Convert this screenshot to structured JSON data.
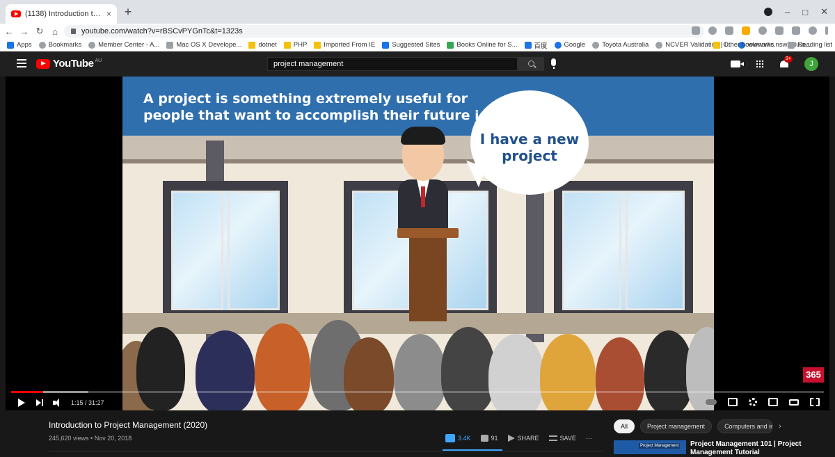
{
  "browser": {
    "tab_title": "(1138) Introduction to Project M",
    "tab_close": "×",
    "new_tab": "+",
    "url": "youtube.com/watch?v=rBSCvPYGnTc&t=1323s",
    "bookmarks": [
      "Apps",
      "Bookmarks",
      "Member Center - A...",
      "Mac OS X Develope...",
      "dotnet",
      "PHP",
      "Imported From IE",
      "Suggested Sites",
      "Books Online for S...",
      "百度",
      "Google",
      "Toyota Australia",
      "NCVER Validation | I...",
      "www.wic.nsw.edu.a..."
    ],
    "other_bookmarks": "Other bookmarks",
    "reading_list": "Reading list"
  },
  "youtube": {
    "logo_text": "YouTube",
    "region": "AU",
    "search_value": "project management",
    "notification_badge": "9+",
    "avatar_letter": "J"
  },
  "video": {
    "banner_line1": "A project is something extremely useful for",
    "banner_line2": "people that want to accomplish their future ideas",
    "bubble_line1": "I have a new",
    "bubble_line2": "project",
    "watermark": "365",
    "time": "1:15 / 31:27",
    "progress_fraction": 0.0397,
    "buffered_fraction": 0.095
  },
  "details": {
    "title": "Introduction to Project Management (2020)",
    "meta": "245,620 views • Nov 20, 2018",
    "likes": "3.4K",
    "dislikes": "91",
    "share": "SHARE",
    "save": "SAVE",
    "more": "···"
  },
  "sidebar": {
    "chips": [
      "All",
      "Project management",
      "Computers and in"
    ],
    "next": "›",
    "rec_thumb_label": "Project Management",
    "rec_title": "Project Management 101 | Project Management Tutorial"
  },
  "colors": {
    "yt_red": "#ff0000",
    "accent_blue": "#3ea6ff",
    "avatar_green": "#3fa53b"
  }
}
